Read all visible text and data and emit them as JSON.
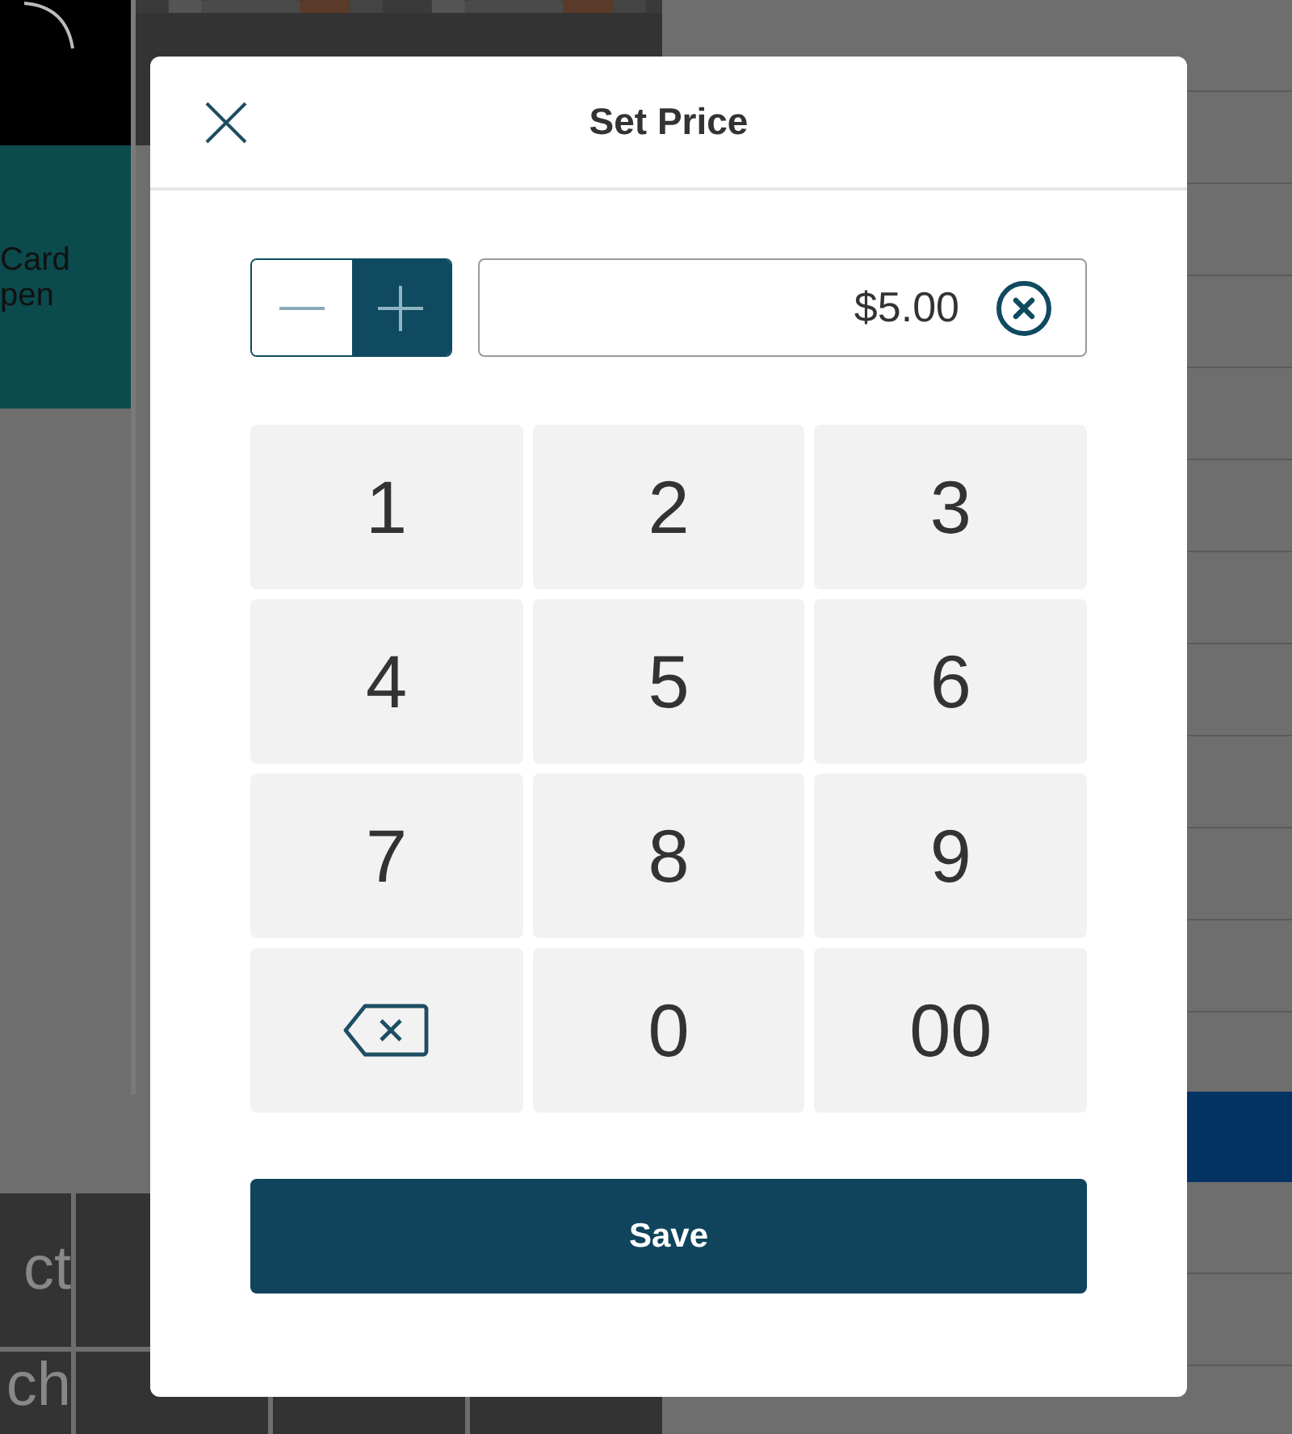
{
  "background": {
    "tile_text": [
      "Card",
      "pen"
    ],
    "pay_grid": [
      [
        "ct"
      ],
      [
        "ch"
      ]
    ]
  },
  "dialog": {
    "title": "Set Price",
    "sign_toggle": [
      {
        "kind": "minus",
        "selected": false
      },
      {
        "kind": "plus",
        "selected": true
      }
    ],
    "amount": {
      "value": "$5.00"
    },
    "keys": [
      {
        "kind": "digit",
        "label": "1"
      },
      {
        "kind": "digit",
        "label": "2"
      },
      {
        "kind": "digit",
        "label": "3"
      },
      {
        "kind": "digit",
        "label": "4"
      },
      {
        "kind": "digit",
        "label": "5"
      },
      {
        "kind": "digit",
        "label": "6"
      },
      {
        "kind": "digit",
        "label": "7"
      },
      {
        "kind": "digit",
        "label": "8"
      },
      {
        "kind": "digit",
        "label": "9"
      },
      {
        "kind": "backspace"
      },
      {
        "kind": "digit",
        "label": "0"
      },
      {
        "kind": "digit",
        "label": "00"
      }
    ],
    "save_button": "Save"
  }
}
